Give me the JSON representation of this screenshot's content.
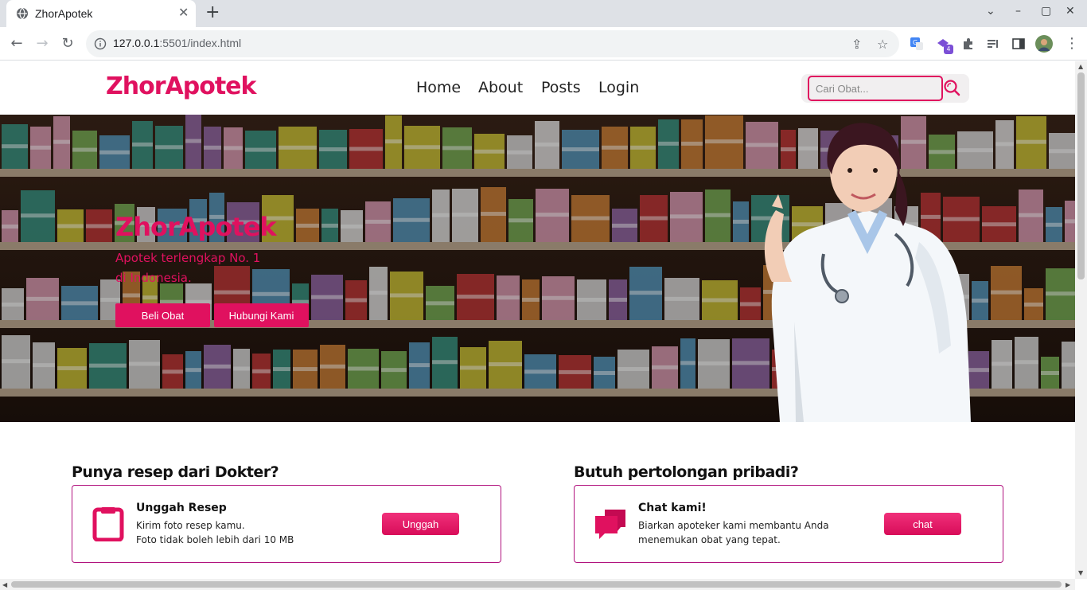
{
  "browser": {
    "tab_title": "ZhorApotek",
    "tab_close": "✕",
    "new_tab": "+",
    "url_host": "127.0.0.1",
    "url_rest": ":5501/index.html",
    "extension_badge": "4",
    "controls": {
      "minimize": "–",
      "maximize": "▢",
      "close": "✕",
      "tablist": "⌄"
    }
  },
  "site": {
    "brand": "ZhorApotek",
    "nav": [
      {
        "label": "Home"
      },
      {
        "label": "About"
      },
      {
        "label": "Posts"
      },
      {
        "label": "Login"
      }
    ],
    "search": {
      "placeholder": "Cari Obat...",
      "value": ""
    }
  },
  "hero": {
    "title": "ZhorApotek",
    "subtitle": "Apotek terlengkap No. 1 di Indonesia.",
    "buttons": [
      {
        "label": "Beli Obat"
      },
      {
        "label": "Hubungi Kami"
      }
    ]
  },
  "sections": [
    {
      "heading": "Punya resep dari Dokter?",
      "card_title": "Unggah Resep",
      "card_line1": "Kirim foto resep kamu.",
      "card_line2": "Foto tidak boleh lebih dari 10 MB",
      "button": "Unggah",
      "icon": "clipboard-icon"
    },
    {
      "heading": "Butuh pertolongan pribadi?",
      "card_title": "Chat kami!",
      "card_line1": "Biarkan apoteker kami membantu Anda",
      "card_line2": "menemukan obat yang tepat.",
      "button": "chat",
      "icon": "chat-bubbles-icon"
    }
  ],
  "colors": {
    "accent": "#e0115f",
    "card_border": "#b1127e"
  }
}
